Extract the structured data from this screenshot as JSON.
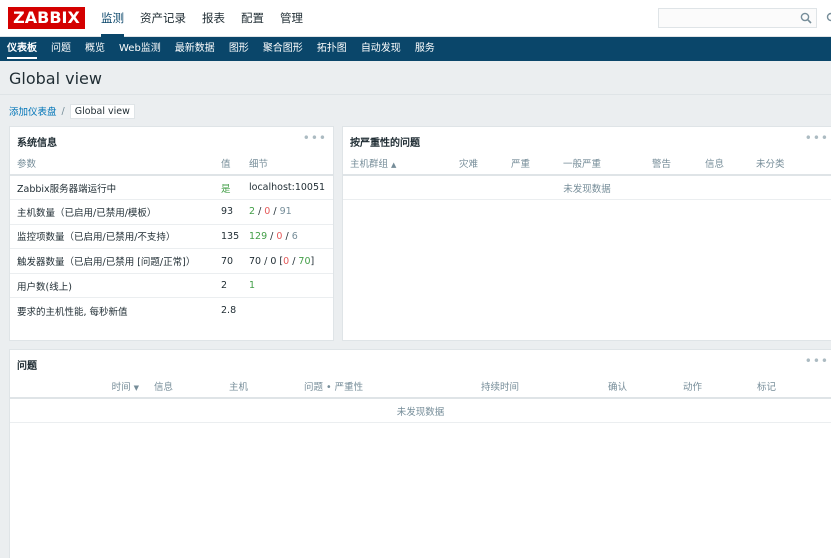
{
  "app": {
    "logo": "ZABBIX"
  },
  "main_menu": [
    "监测",
    "资产记录",
    "报表",
    "配置",
    "管理"
  ],
  "sub_menu": [
    "仪表板",
    "问题",
    "概览",
    "Web监测",
    "最新数据",
    "图形",
    "聚合图形",
    "拓扑图",
    "自动发现",
    "服务"
  ],
  "page": {
    "title": "Global view"
  },
  "breadcrumb": {
    "root": "添加仪表盘",
    "separator": "/",
    "current": "Global view"
  },
  "widgets": {
    "system_info": {
      "title": "系统信息",
      "menu": "•••",
      "columns": [
        "参数",
        "值",
        "细节"
      ],
      "rows": [
        {
          "param": "Zabbix服务器端运行中",
          "value": "是",
          "detail": "localhost:10051"
        },
        {
          "param": "主机数量（已启用/已禁用/模板）",
          "value": "93",
          "d1": "2",
          "d2": "0",
          "d3": "91"
        },
        {
          "param": "监控项数量（已启用/已禁用/不支持）",
          "value": "135",
          "d1": "129",
          "d2": "0",
          "d3": "6"
        },
        {
          "param": "触发器数量（已启用/已禁用 [问题/正常]）",
          "value": "70",
          "d1": "70",
          "d2": "0",
          "d3": "0",
          "d4": "70"
        },
        {
          "param": "用户数(线上)",
          "value": "2",
          "d1": "1"
        },
        {
          "param": "要求的主机性能, 每秒新值",
          "value": "2.8"
        }
      ]
    },
    "problems_by_severity": {
      "title": "按严重性的问题",
      "menu": "•••",
      "columns": [
        "主机群组",
        "灾难",
        "严重",
        "一般严重",
        "警告",
        "信息",
        "未分类"
      ],
      "sort_arrow": "▲",
      "no_data": "未发现数据"
    },
    "problems": {
      "title": "问题",
      "menu": "•••",
      "columns": [
        "时间",
        "信息",
        "主机",
        "问题 • 严重性",
        "持续时间",
        "确认",
        "动作",
        "标记"
      ],
      "sort_arrow": "▼",
      "no_data": "未发现数据"
    }
  },
  "colors": {
    "brand": "#d40000",
    "nav": "#0a466a",
    "ok": "#429e47",
    "problem": "#e45959",
    "link": "#0275b8"
  },
  "icons": {
    "search": "search-icon",
    "settings": "settings-icon",
    "widget_menu": "more-icon"
  }
}
